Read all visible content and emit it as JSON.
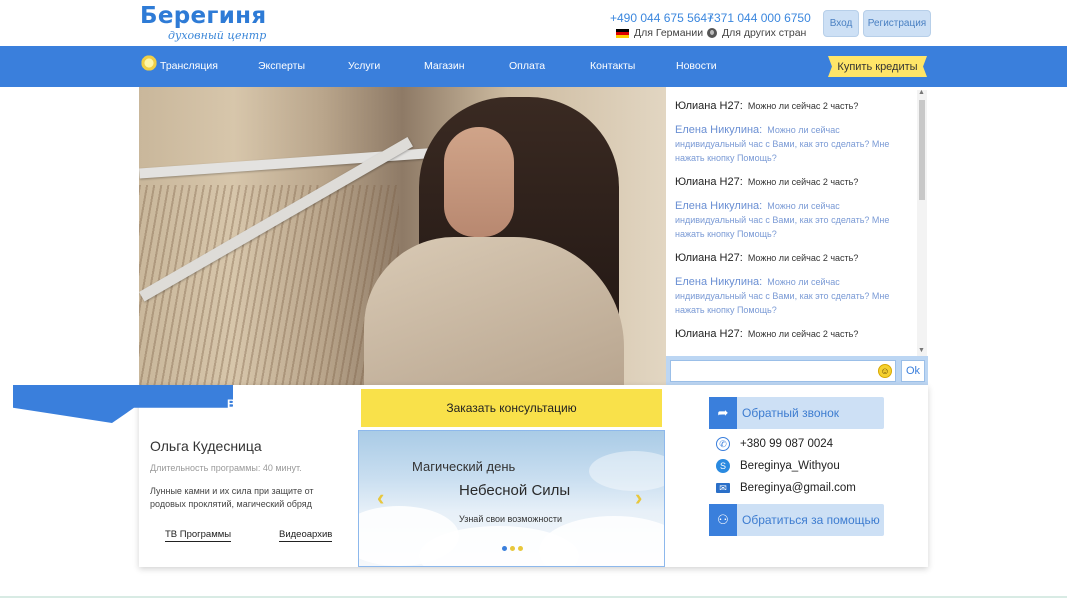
{
  "logo": {
    "title": "Берегиня",
    "subtitle": "духовный центр"
  },
  "contacts_header": {
    "phone_de": "+490 044 675 5647",
    "loc_de": "Для Германии",
    "phone_other": "+371 044 000 6750",
    "loc_other": "Для других стран"
  },
  "auth": {
    "login": "Вход",
    "register": "Регистрация"
  },
  "nav": {
    "items": [
      "Трансляция",
      "Эксперты",
      "Услуги",
      "Магазин",
      "Оплата",
      "Контакты",
      "Новости"
    ],
    "credits": "Купить кредиты"
  },
  "chat": {
    "messages": [
      {
        "name": "Юлиана Н27:",
        "text": "Можно ли сейчас 2 часть?"
      },
      {
        "name": "Елена Никулина:",
        "text": "Можно ли сейчас индивидуальный час с Вами, как это сделать? Мне нажать кнопку Помощь?"
      },
      {
        "name": "Юлиана Н27:",
        "text": "Можно ли сейчас 2 часть?"
      },
      {
        "name": "Елена Никулина:",
        "text": "Можно ли сейчас индивидуальный час с Вами, как это сделать? Мне нажать кнопку Помощь?"
      },
      {
        "name": "Юлиана Н27:",
        "text": "Можно ли сейчас 2 часть?"
      },
      {
        "name": "Елена Никулина:",
        "text": "Можно ли сейчас индивидуальный час с Вами, как это сделать? Мне нажать кнопку Помощь?"
      },
      {
        "name": "Юлиана Н27:",
        "text": "Можно ли сейчас 2 часть?"
      }
    ],
    "input_value": "",
    "ok_label": "Ok"
  },
  "program": {
    "ribbon_text": "В",
    "expert": "Ольга Кудесница",
    "duration": "Длительность программы: 40 минут.",
    "description": "Лунные камни и их сила при защите от родовых проклятий, магический обряд",
    "link_tv": "ТВ Программы",
    "link_archive": "Видеоархив"
  },
  "consult": {
    "label": "Заказать консультацию"
  },
  "slider": {
    "title": "Магический день",
    "subtitle": "Небесной Силы",
    "tagline": "Узнай свои возможности",
    "prev": "‹",
    "next": "›"
  },
  "side": {
    "callback": "Обратный звонок",
    "phone": "+380 99 087 0024",
    "skype": "Bereginya_Withyou",
    "email": "Bereginya@gmail.com",
    "help": "Обратиться за помощью"
  },
  "icons": {
    "flag": "germany-flag-icon",
    "globe": "globe-icon",
    "viber": "viber-icon",
    "skype": "skype-icon",
    "mail": "mail-icon",
    "share": "share-arrow-icon",
    "person": "person-help-icon",
    "smile": "smiley-icon"
  },
  "colors": {
    "brand_blue": "#3a7fdc",
    "accent_yellow": "#f9e14a",
    "light_blue": "#cde0f5"
  }
}
